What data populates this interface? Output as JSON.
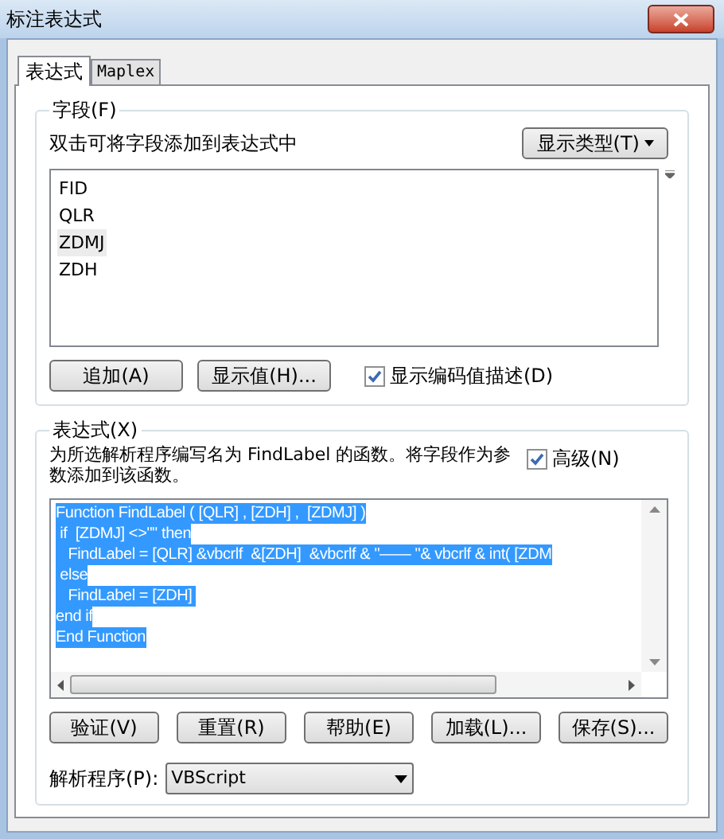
{
  "window": {
    "title": "标注表达式"
  },
  "tabs": [
    {
      "label": "表达式",
      "selected": true
    },
    {
      "label": "Maplex",
      "selected": false
    }
  ],
  "fields_group": {
    "legend": "字段(F)",
    "hint": "双击可将字段添加到表达式中",
    "show_type_button": "显示类型(T)",
    "fields": [
      {
        "label": "FID",
        "selected": false
      },
      {
        "label": "QLR",
        "selected": false
      },
      {
        "label": "ZDMJ",
        "selected": true
      },
      {
        "label": "ZDH",
        "selected": false
      }
    ],
    "buttons": [
      "追加(A)",
      "显示值(H)..."
    ],
    "show_coded": {
      "label": "显示编码值描述(D)",
      "checked": true
    }
  },
  "expression_group": {
    "legend": "表达式(X)",
    "description": "为所选解析程序编写名为 FindLabel 的函数。将字段作为参数添加到该函数。",
    "advanced": {
      "label": "高级(N)",
      "checked": true
    },
    "code_selected": true,
    "code_lines": [
      "Function FindLabel ( [QLR] , [ZDH] ,  [ZDMJ] )",
      " if  [ZDMJ] <>\"\" then",
      "   FindLabel = [QLR] &vbcrlf  &[ZDH]  &vbcrlf & \"—— \"& vbcrlf & int( [ZDM",
      " else",
      "   FindLabel = [ZDH] ",
      "end if",
      "End Function"
    ],
    "buttons": [
      "验证(V)",
      "重置(R)",
      "帮助(E)",
      "加载(L)...",
      "保存(S)..."
    ],
    "parser": {
      "label": "解析程序(P):",
      "value": "VBScript"
    }
  }
}
